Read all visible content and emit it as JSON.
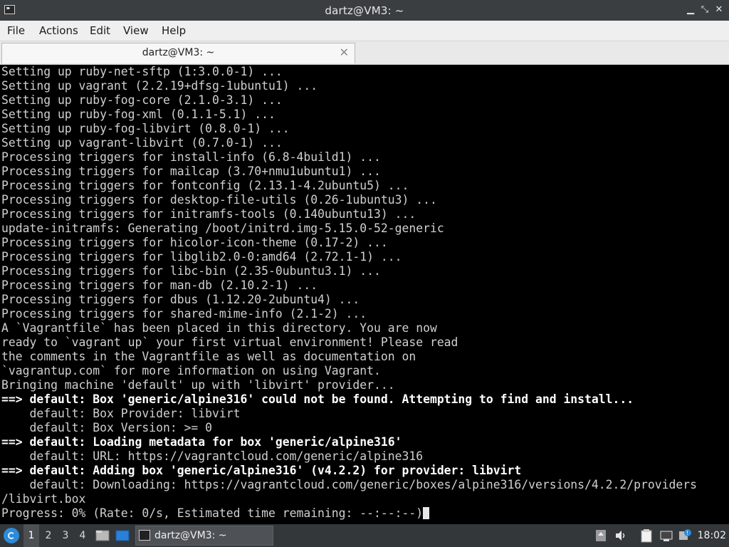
{
  "window": {
    "title": "dartz@VM3: ~"
  },
  "menu": [
    {
      "label": "File"
    },
    {
      "label": "Actions"
    },
    {
      "label": "Edit"
    },
    {
      "label": "View"
    },
    {
      "label": "Help"
    }
  ],
  "tab": {
    "label": "dartz@VM3: ~",
    "close": "✕"
  },
  "terminal": {
    "lines": [
      {
        "text": "Setting up ruby-net-sftp (1:3.0.0-1) ...",
        "bold": false
      },
      {
        "text": "Setting up vagrant (2.2.19+dfsg-1ubuntu1) ...",
        "bold": false
      },
      {
        "text": "Setting up ruby-fog-core (2.1.0-3.1) ...",
        "bold": false
      },
      {
        "text": "Setting up ruby-fog-xml (0.1.1-5.1) ...",
        "bold": false
      },
      {
        "text": "Setting up ruby-fog-libvirt (0.8.0-1) ...",
        "bold": false
      },
      {
        "text": "Setting up vagrant-libvirt (0.7.0-1) ...",
        "bold": false
      },
      {
        "text": "Processing triggers for install-info (6.8-4build1) ...",
        "bold": false
      },
      {
        "text": "Processing triggers for mailcap (3.70+nmu1ubuntu1) ...",
        "bold": false
      },
      {
        "text": "Processing triggers for fontconfig (2.13.1-4.2ubuntu5) ...",
        "bold": false
      },
      {
        "text": "Processing triggers for desktop-file-utils (0.26-1ubuntu3) ...",
        "bold": false
      },
      {
        "text": "Processing triggers for initramfs-tools (0.140ubuntu13) ...",
        "bold": false
      },
      {
        "text": "update-initramfs: Generating /boot/initrd.img-5.15.0-52-generic",
        "bold": false
      },
      {
        "text": "Processing triggers for hicolor-icon-theme (0.17-2) ...",
        "bold": false
      },
      {
        "text": "Processing triggers for libglib2.0-0:amd64 (2.72.1-1) ...",
        "bold": false
      },
      {
        "text": "Processing triggers for libc-bin (2.35-0ubuntu3.1) ...",
        "bold": false
      },
      {
        "text": "Processing triggers for man-db (2.10.2-1) ...",
        "bold": false
      },
      {
        "text": "Processing triggers for dbus (1.12.20-2ubuntu4) ...",
        "bold": false
      },
      {
        "text": "Processing triggers for shared-mime-info (2.1-2) ...",
        "bold": false
      },
      {
        "text": "A `Vagrantfile` has been placed in this directory. You are now",
        "bold": false
      },
      {
        "text": "ready to `vagrant up` your first virtual environment! Please read",
        "bold": false
      },
      {
        "text": "the comments in the Vagrantfile as well as documentation on",
        "bold": false
      },
      {
        "text": "`vagrantup.com` for more information on using Vagrant.",
        "bold": false
      },
      {
        "text": "Bringing machine 'default' up with 'libvirt' provider...",
        "bold": false
      },
      {
        "text": "==> default: Box 'generic/alpine316' could not be found. Attempting to find and install...",
        "bold": true
      },
      {
        "text": "    default: Box Provider: libvirt",
        "bold": false
      },
      {
        "text": "    default: Box Version: >= 0",
        "bold": false
      },
      {
        "text": "==> default: Loading metadata for box 'generic/alpine316'",
        "bold": true
      },
      {
        "text": "    default: URL: https://vagrantcloud.com/generic/alpine316",
        "bold": false
      },
      {
        "text": "==> default: Adding box 'generic/alpine316' (v4.2.2) for provider: libvirt",
        "bold": true
      },
      {
        "text": "    default: Downloading: https://vagrantcloud.com/generic/boxes/alpine316/versions/4.2.2/providers",
        "bold": false
      },
      {
        "text": "/libvirt.box",
        "bold": false
      },
      {
        "text": "Progress: 0% (Rate: 0/s, Estimated time remaining: --:--:--)",
        "bold": false
      }
    ]
  },
  "taskbar": {
    "workspaces": [
      "1",
      "2",
      "3",
      "4"
    ],
    "task_label": "dartz@VM3: ~",
    "clock": "18:02"
  },
  "colors": {
    "terminal_bg": "#000000",
    "titlebar_bg": "#3b3e41",
    "taskbar_bg": "#33373a"
  }
}
